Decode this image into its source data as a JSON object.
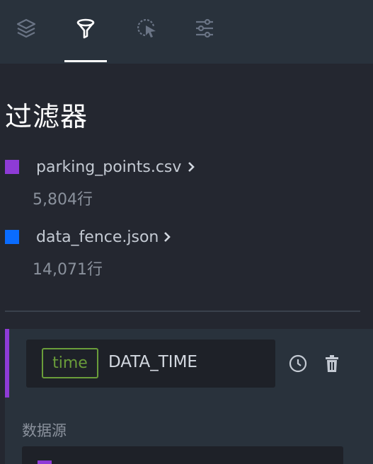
{
  "tabs": [
    {
      "icon": "layers-icon",
      "active": false
    },
    {
      "icon": "filter-icon",
      "active": true
    },
    {
      "icon": "cursor-icon",
      "active": false
    },
    {
      "icon": "sliders-icon",
      "active": false
    }
  ],
  "panel": {
    "title": "过滤器"
  },
  "datasets": [
    {
      "name": "parking_points.csv",
      "rows": "5,804行",
      "color": "#8e3bd6"
    },
    {
      "name": "data_fence.json",
      "rows": "14,071行",
      "color": "#0a6cff"
    }
  ],
  "filter": {
    "accent_color": "#8e3bd6",
    "field_type": "time",
    "field_name": "DATA_TIME",
    "source_label": "数据源"
  },
  "colors": {
    "background": "#242730",
    "tabbar": "#29323c",
    "time_badge": "#6a9d3a"
  }
}
